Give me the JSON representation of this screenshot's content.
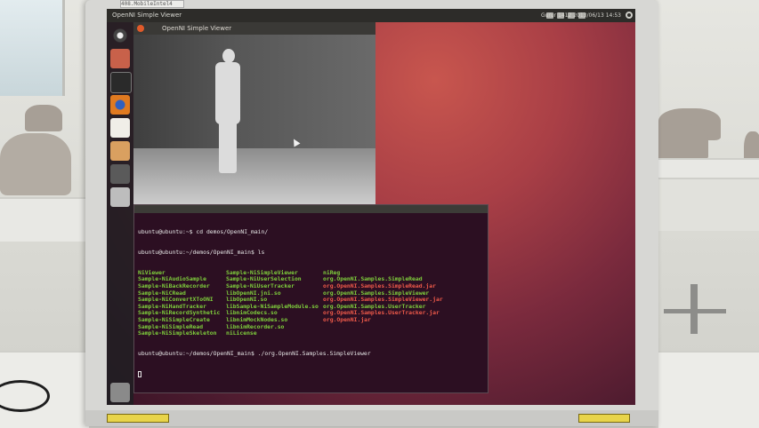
{
  "sticker_top": "408.MobileIntel4",
  "top_panel": {
    "title": "OpenNI Simple Viewer",
    "clock": "Gurur 1412 2013/06/13 14:53"
  },
  "viewer": {
    "title": "OpenNI Simple Viewer"
  },
  "terminal": {
    "lines": [
      {
        "kind": "prompt",
        "text": "ubuntu@ubuntu:~$ cd demos/OpenNI_main/"
      },
      {
        "kind": "prompt",
        "text": "ubuntu@ubuntu:~/demos/OpenNI_main$ ls"
      }
    ],
    "listing": [
      [
        {
          "t": "NiViewer",
          "c": "green"
        },
        {
          "t": "Sample-NiSimpleViewer",
          "c": "green"
        },
        {
          "t": "niReg",
          "c": "green"
        }
      ],
      [
        {
          "t": "Sample-NiAudioSample",
          "c": "green"
        },
        {
          "t": "Sample-NiUserSelection",
          "c": "green"
        },
        {
          "t": "org.OpenNI.Samples.SimpleRead",
          "c": "green"
        }
      ],
      [
        {
          "t": "Sample-NiBackRecorder",
          "c": "green"
        },
        {
          "t": "Sample-NiUserTracker",
          "c": "green"
        },
        {
          "t": "org.OpenNI.Samples.SimpleRead.jar",
          "c": "red"
        }
      ],
      [
        {
          "t": "Sample-NiCRead",
          "c": "green"
        },
        {
          "t": "libOpenNI.jni.so",
          "c": "green"
        },
        {
          "t": "org.OpenNI.Samples.SimpleViewer",
          "c": "green"
        }
      ],
      [
        {
          "t": "Sample-NiConvertXToONI",
          "c": "green"
        },
        {
          "t": "libOpenNI.so",
          "c": "green"
        },
        {
          "t": "org.OpenNI.Samples.SimpleViewer.jar",
          "c": "red"
        }
      ],
      [
        {
          "t": "Sample-NiHandTracker",
          "c": "green"
        },
        {
          "t": "libSample-NiSampleModule.so",
          "c": "green"
        },
        {
          "t": "org.OpenNI.Samples.UserTracker",
          "c": "green"
        }
      ],
      [
        {
          "t": "Sample-NiRecordSynthetic",
          "c": "green"
        },
        {
          "t": "libnimCodecs.so",
          "c": "green"
        },
        {
          "t": "org.OpenNI.Samples.UserTracker.jar",
          "c": "red"
        }
      ],
      [
        {
          "t": "Sample-NiSimpleCreate",
          "c": "green"
        },
        {
          "t": "libnimMockNodes.so",
          "c": "green"
        },
        {
          "t": "org.OpenNI.jar",
          "c": "red"
        }
      ],
      [
        {
          "t": "Sample-NiSimpleRead",
          "c": "green"
        },
        {
          "t": "libnimRecorder.so",
          "c": "green"
        },
        {
          "t": "",
          "c": "white"
        }
      ],
      [
        {
          "t": "Sample-NiSimpleSkeleton",
          "c": "green"
        },
        {
          "t": "niLicense",
          "c": "green"
        },
        {
          "t": "",
          "c": "white"
        }
      ]
    ],
    "last_command": "ubuntu@ubuntu:~/demos/OpenNI_main$ ./org.OpenNI.Samples.SimpleViewer"
  },
  "colors": {
    "terminal_bg": "#2c0f22",
    "desktop_accent": "#a93f46",
    "green": "#7fcf3c",
    "red": "#ef5a4a"
  }
}
